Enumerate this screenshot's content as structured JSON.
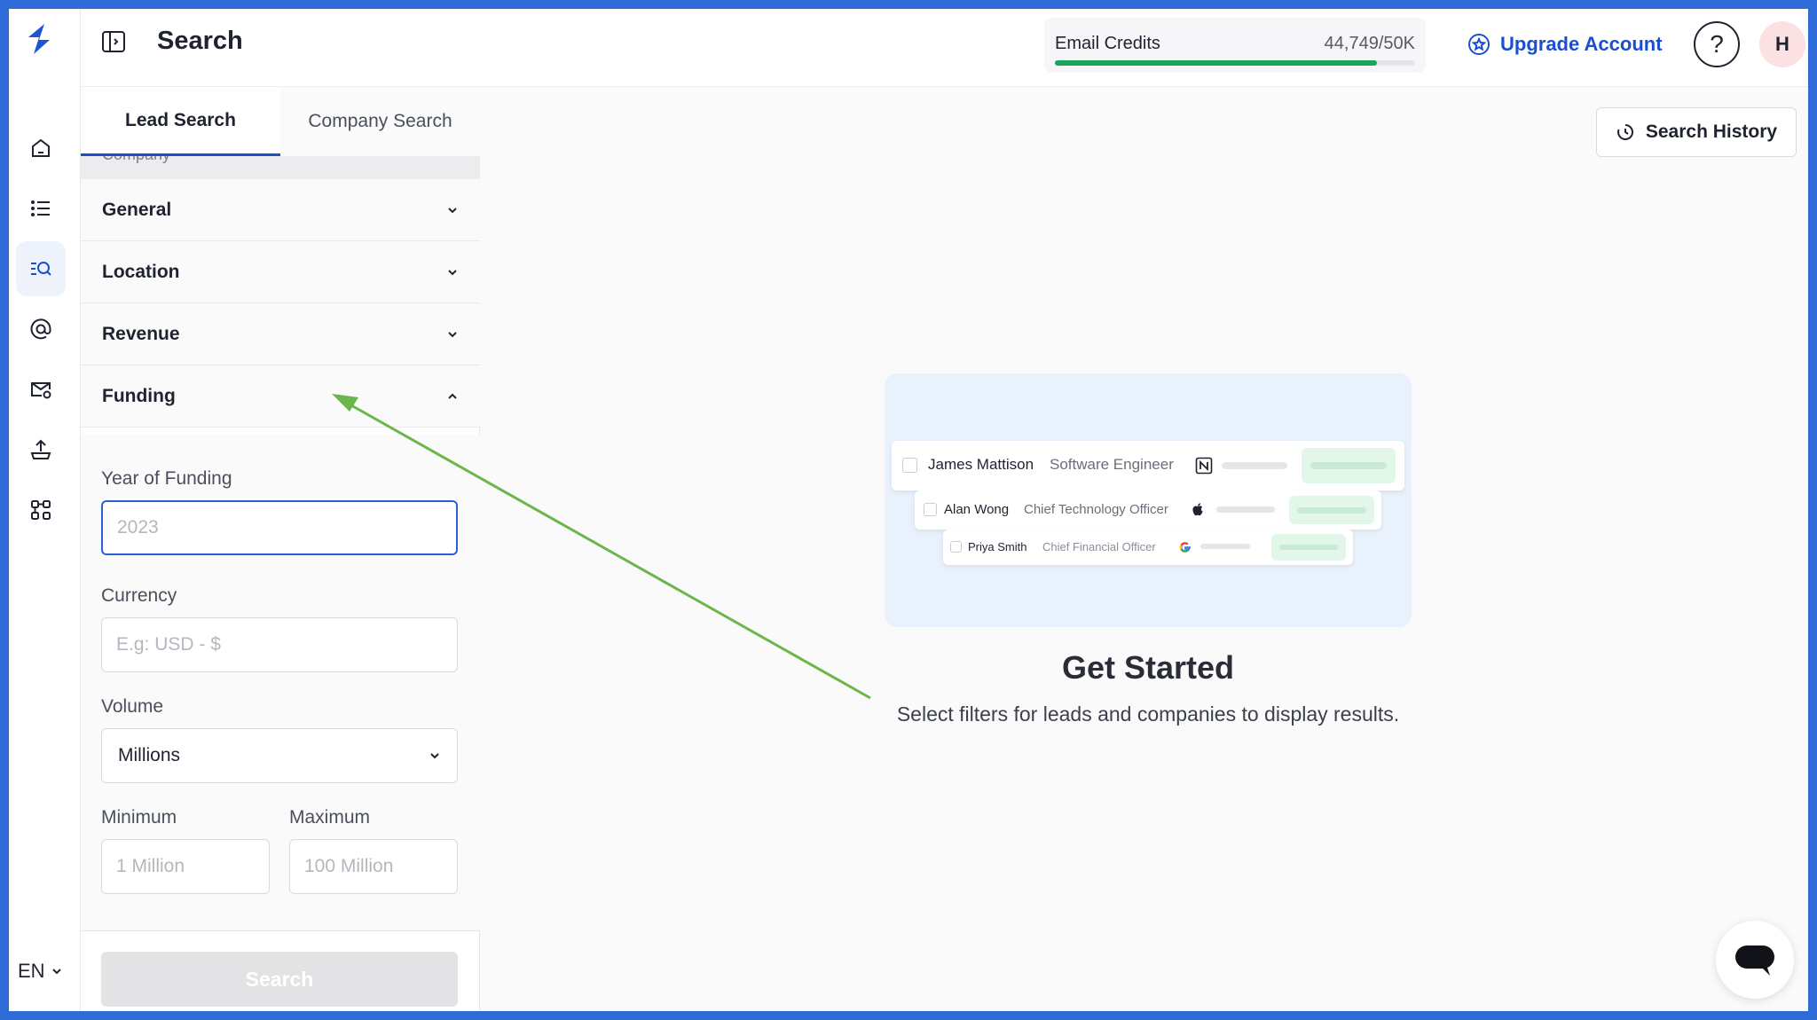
{
  "topbar": {
    "title": "Search",
    "credits_label": "Email Credits",
    "credits_value": "44,749/50K",
    "credits_fraction": 0.895,
    "upgrade_label": "Upgrade Account",
    "help_glyph": "?",
    "avatar_initial": "H"
  },
  "rail": {
    "items": [
      "home-icon",
      "list-icon",
      "search-list-icon",
      "at-sign-icon",
      "mail-settings-icon",
      "upload-icon",
      "integrations-icon"
    ],
    "active_index": 2,
    "language": "EN"
  },
  "panel": {
    "tabs": [
      {
        "label": "Lead Search",
        "active": true
      },
      {
        "label": "Company Search",
        "active": false
      }
    ],
    "peek_label": "Company",
    "accordions": [
      {
        "label": "General",
        "expanded": false
      },
      {
        "label": "Location",
        "expanded": false
      },
      {
        "label": "Revenue",
        "expanded": false
      },
      {
        "label": "Funding",
        "expanded": true
      }
    ],
    "funding": {
      "year_label": "Year of Funding",
      "year_placeholder": "2023",
      "currency_label": "Currency",
      "currency_placeholder": "E.g: USD - $",
      "volume_label": "Volume",
      "volume_value": "Millions",
      "min_label": "Minimum",
      "min_placeholder": "1 Million",
      "max_label": "Maximum",
      "max_placeholder": "100 Million"
    },
    "search_button": "Search"
  },
  "main": {
    "history_button": "Search History",
    "illustration_rows": [
      {
        "name": "James Mattison",
        "title": "Software Engineer",
        "logo": "notion-icon"
      },
      {
        "name": "Alan Wong",
        "title": "Chief Technology Officer",
        "logo": "apple-icon"
      },
      {
        "name": "Priya Smith",
        "title": "Chief Financial Officer",
        "logo": "google-icon"
      }
    ],
    "heading": "Get Started",
    "subtitle": "Select filters for leads and companies to display results."
  },
  "colors": {
    "accent": "#1a4fcf",
    "credits_bar": "#1aa55a",
    "annotation_arrow": "#6ab64a",
    "frame": "#2e6bd6"
  }
}
